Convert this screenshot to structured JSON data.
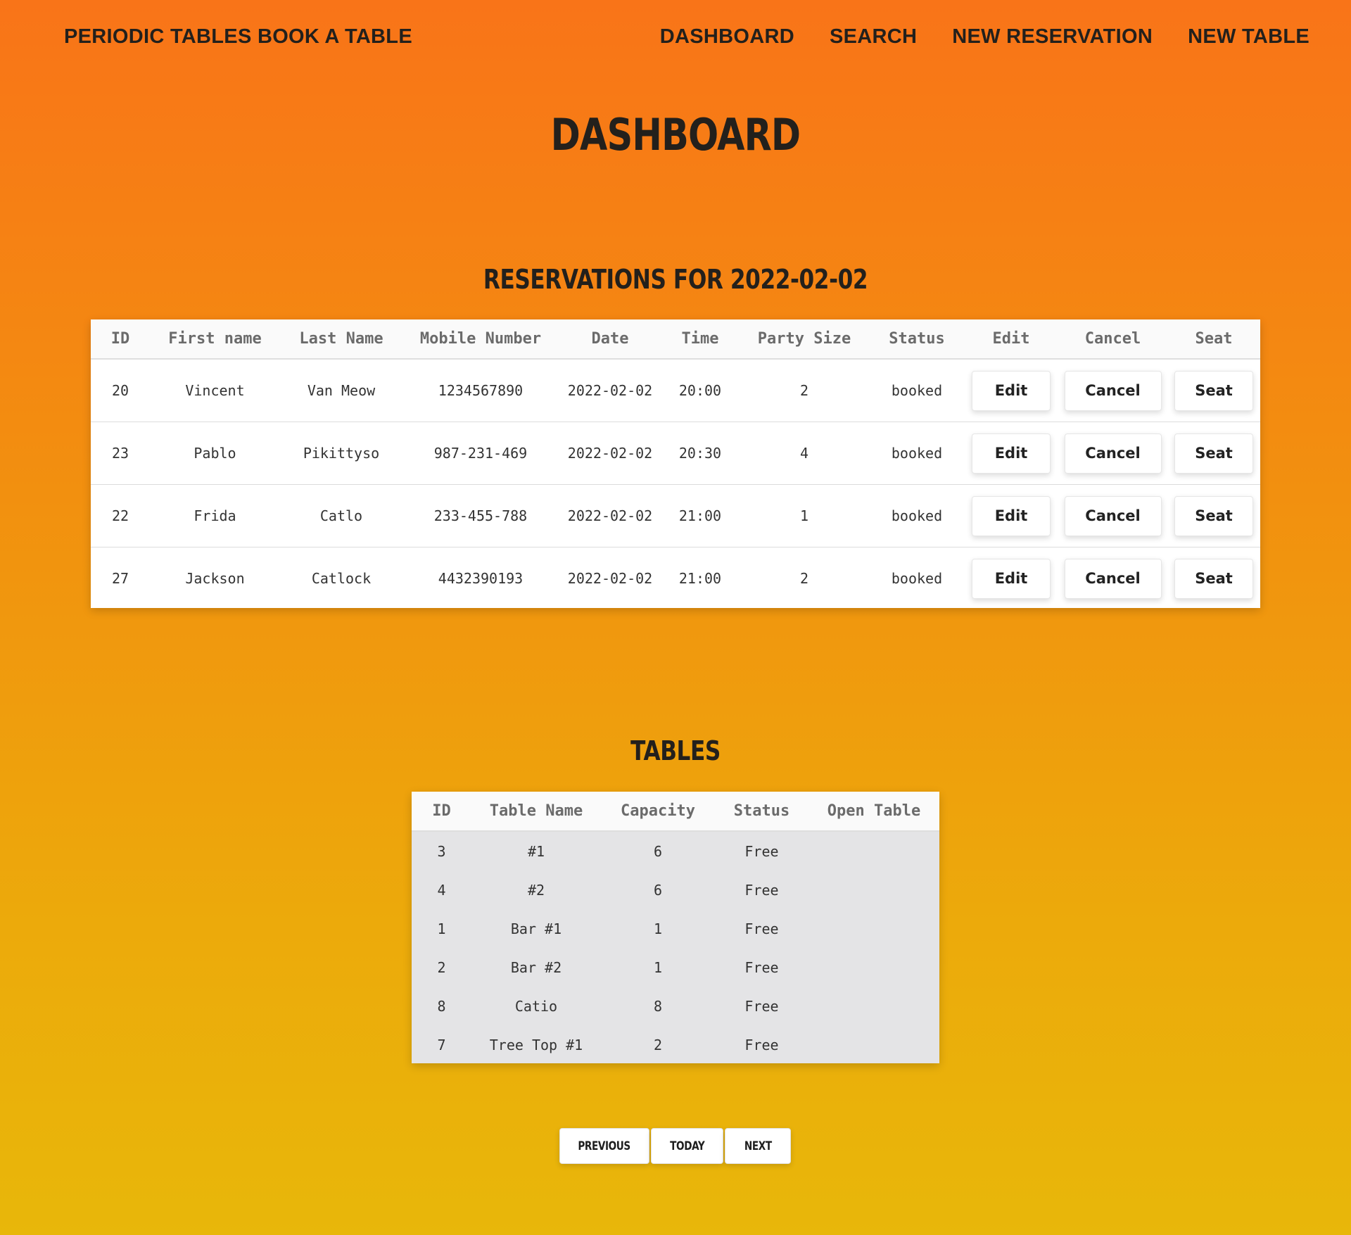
{
  "nav": {
    "brand": "PERIODIC TABLES BOOK A TABLE",
    "links": [
      "DASHBOARD",
      "SEARCH",
      "NEW RESERVATION",
      "NEW TABLE"
    ]
  },
  "page": {
    "title": "DASHBOARD",
    "reservations_heading": "RESERVATIONS FOR 2022-02-02",
    "tables_heading": "TABLES"
  },
  "reservations": {
    "columns": [
      "ID",
      "First name",
      "Last Name",
      "Mobile Number",
      "Date",
      "Time",
      "Party Size",
      "Status",
      "Edit",
      "Cancel",
      "Seat"
    ],
    "rows": [
      {
        "id": "20",
        "first": "Vincent",
        "last": "Van Meow",
        "mobile": "1234567890",
        "date": "2022-02-02",
        "time": "20:00",
        "party": "2",
        "status": "booked"
      },
      {
        "id": "23",
        "first": "Pablo",
        "last": "Pikittyso",
        "mobile": "987-231-469",
        "date": "2022-02-02",
        "time": "20:30",
        "party": "4",
        "status": "booked"
      },
      {
        "id": "22",
        "first": "Frida",
        "last": "Catlo",
        "mobile": "233-455-788",
        "date": "2022-02-02",
        "time": "21:00",
        "party": "1",
        "status": "booked"
      },
      {
        "id": "27",
        "first": "Jackson",
        "last": "Catlock",
        "mobile": "4432390193",
        "date": "2022-02-02",
        "time": "21:00",
        "party": "2",
        "status": "booked"
      }
    ],
    "button_labels": {
      "edit": "Edit",
      "cancel": "Cancel",
      "seat": "Seat"
    }
  },
  "tables": {
    "columns": [
      "ID",
      "Table Name",
      "Capacity",
      "Status",
      "Open Table"
    ],
    "rows": [
      {
        "id": "3",
        "name": "#1",
        "capacity": "6",
        "status": "Free"
      },
      {
        "id": "4",
        "name": "#2",
        "capacity": "6",
        "status": "Free"
      },
      {
        "id": "1",
        "name": "Bar #1",
        "capacity": "1",
        "status": "Free"
      },
      {
        "id": "2",
        "name": "Bar #2",
        "capacity": "1",
        "status": "Free"
      },
      {
        "id": "8",
        "name": "Catio",
        "capacity": "8",
        "status": "Free"
      },
      {
        "id": "7",
        "name": "Tree Top #1",
        "capacity": "2",
        "status": "Free"
      }
    ]
  },
  "pager": {
    "previous": "PREVIOUS",
    "today": "TODAY",
    "next": "NEXT"
  },
  "colors": {
    "gradient_top": "#f97418",
    "gradient_bottom": "#e8b70a",
    "text_dark": "#23201c"
  }
}
